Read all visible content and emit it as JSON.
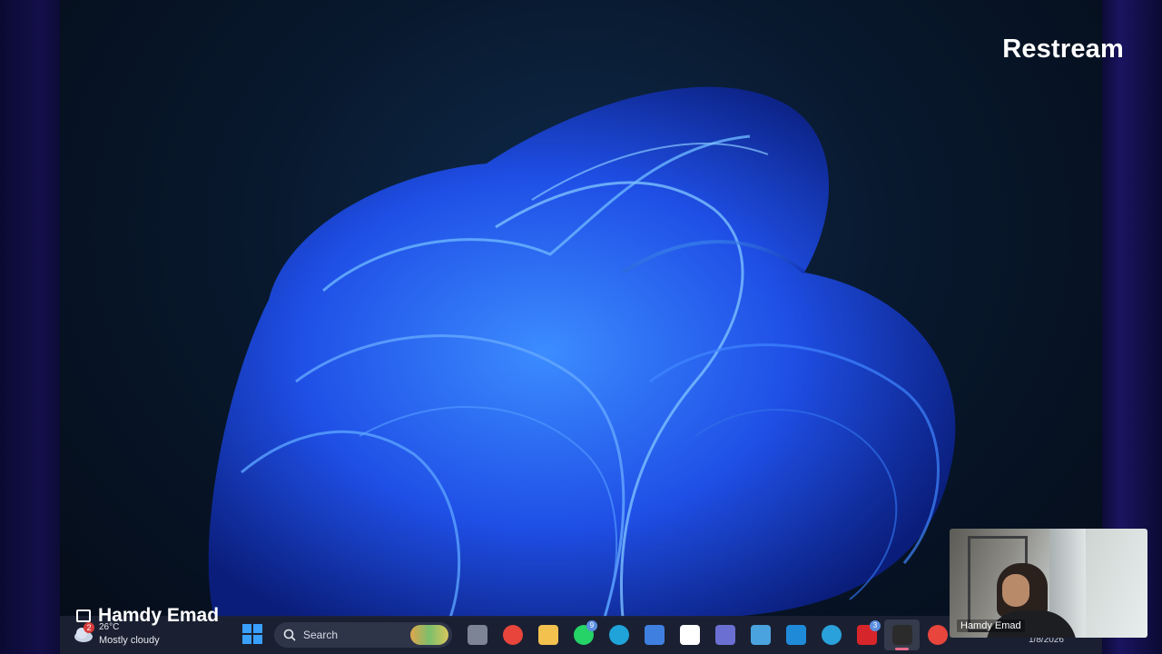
{
  "brand": {
    "logo_text": "Restream"
  },
  "presenter": {
    "name": "Hamdy Emad"
  },
  "weather": {
    "badge": "2",
    "temperature": "26°C",
    "condition": "Mostly cloudy"
  },
  "search": {
    "placeholder": "Search"
  },
  "taskbar_apps": [
    {
      "name": "task-view-icon",
      "color": "#7c8496"
    },
    {
      "name": "chrome-icon",
      "color": "#e8453c"
    },
    {
      "name": "file-explorer-icon",
      "color": "#f2c14e"
    },
    {
      "name": "whatsapp-icon",
      "color": "#25d366",
      "badge": "9"
    },
    {
      "name": "edge-icon",
      "color": "#1fa3d8"
    },
    {
      "name": "editor-icon",
      "color": "#3f7fe0"
    },
    {
      "name": "store-icon",
      "color": "#ffffff"
    },
    {
      "name": "teams-icon",
      "color": "#6b6fd1"
    },
    {
      "name": "cloud-app-icon",
      "color": "#4aa3df"
    },
    {
      "name": "vscode-icon",
      "color": "#1f8ad8"
    },
    {
      "name": "telegram-icon",
      "color": "#2aa1da"
    },
    {
      "name": "l-app-icon",
      "color": "#d7262b",
      "badge": "3"
    },
    {
      "name": "webex-icon",
      "color": "#2b2b2b",
      "active": true
    },
    {
      "name": "chrome-profile-icon",
      "color": "#e8453c"
    }
  ],
  "clock": {
    "date": "1/8/2026"
  },
  "webcam": {
    "label": "Hamdy Emad"
  }
}
